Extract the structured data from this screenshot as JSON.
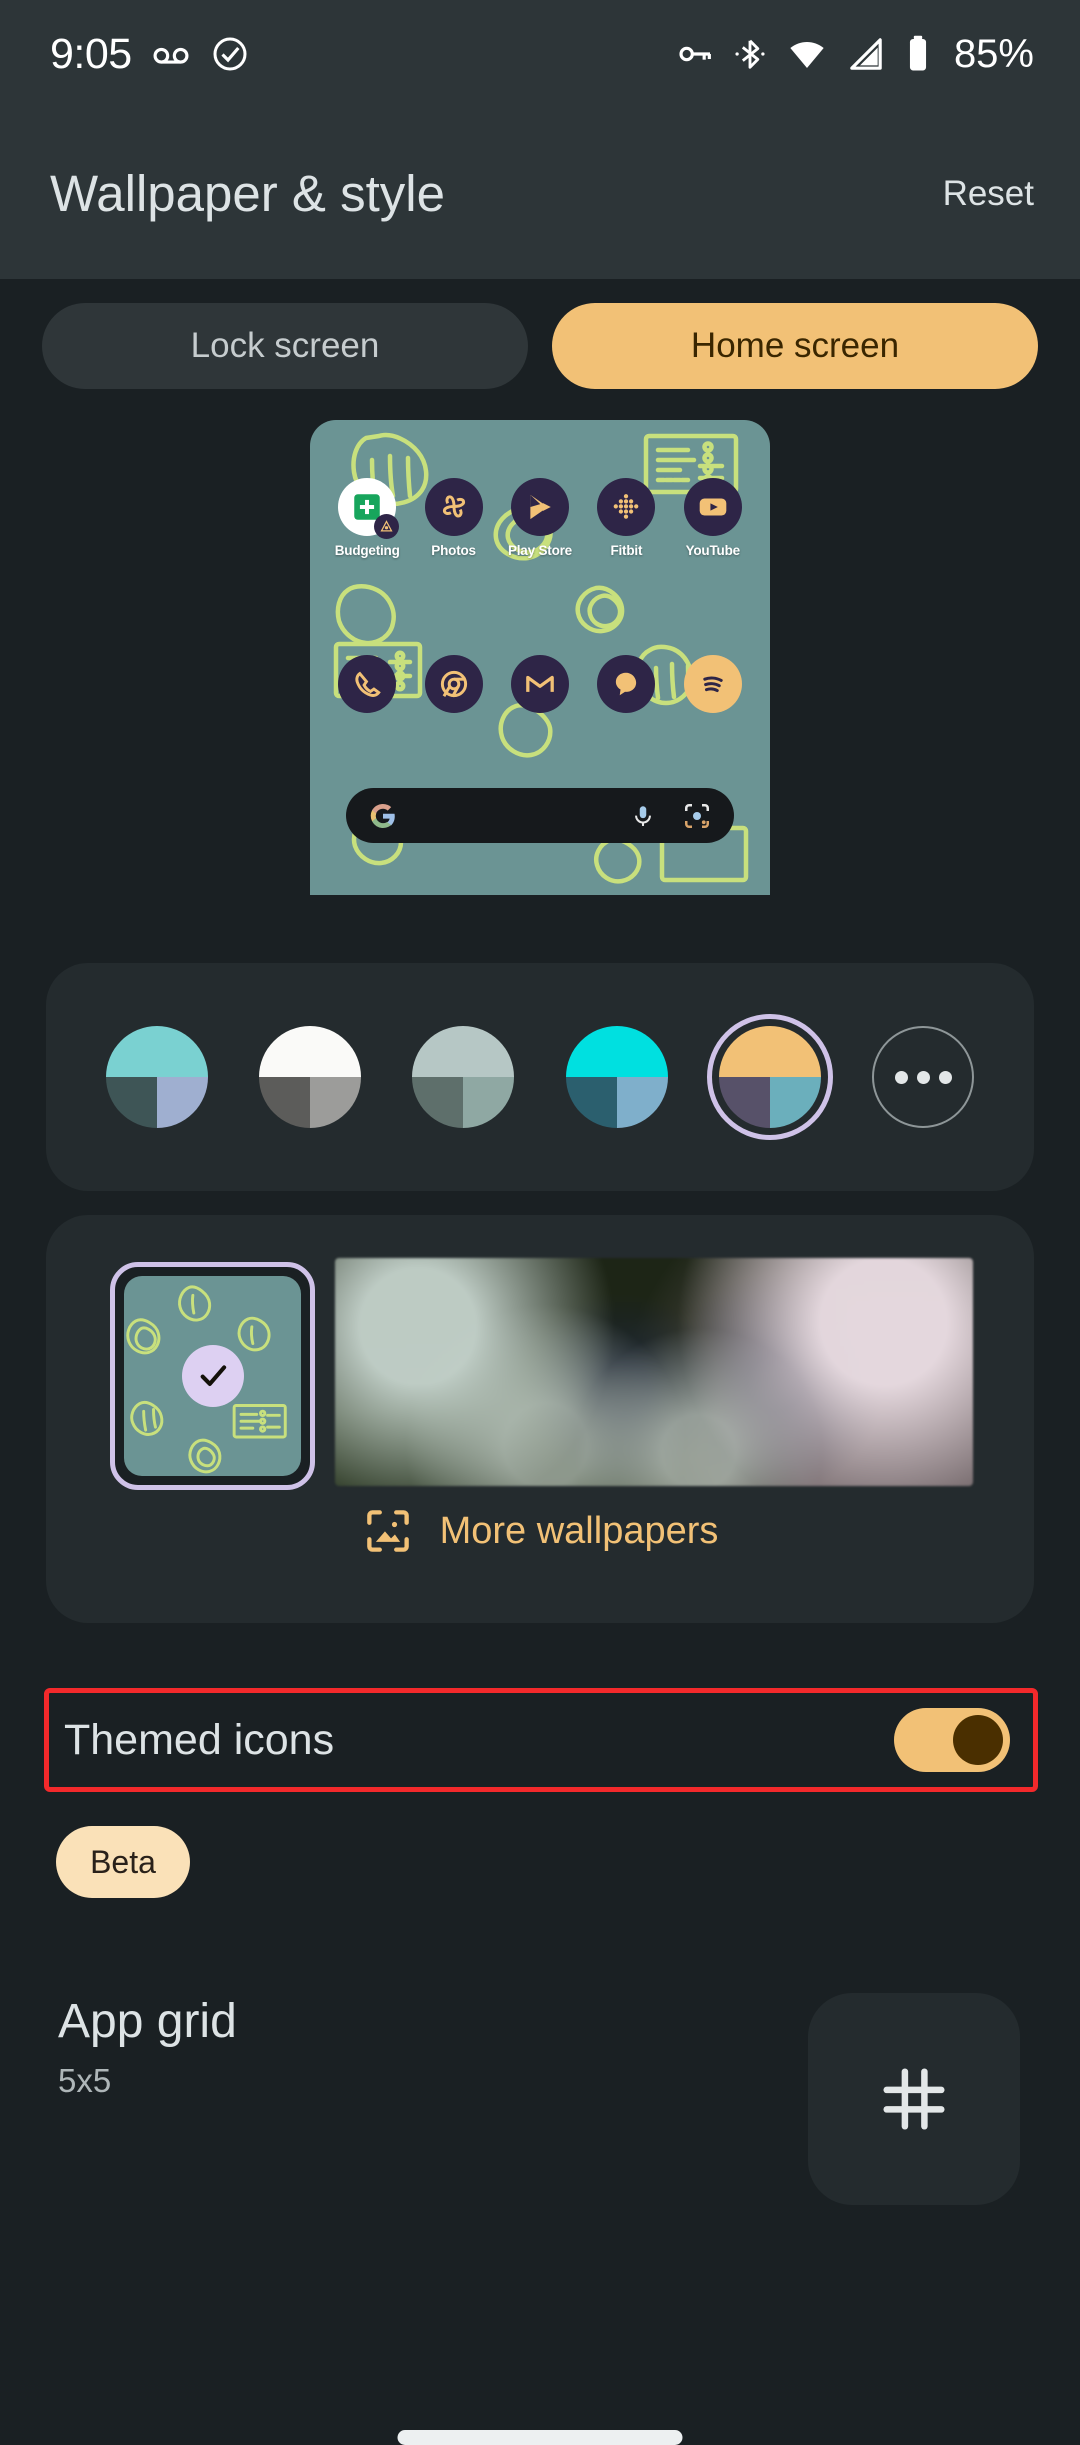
{
  "status_bar": {
    "time": "9:05",
    "battery_percent": "85%",
    "left_icons": [
      "voicemail-icon",
      "check-circle-icon"
    ],
    "right_icons": [
      "vpn-key-icon",
      "bluetooth-icon",
      "wifi-icon",
      "cell-signal-icon",
      "battery-icon"
    ]
  },
  "header": {
    "title": "Wallpaper & style",
    "reset_label": "Reset"
  },
  "tabs": [
    {
      "label": "Lock screen",
      "active": false
    },
    {
      "label": "Home screen",
      "active": true
    }
  ],
  "preview": {
    "wallpaper_bg": "#6B9494",
    "doodle_color": "#C8E07D",
    "row1": [
      {
        "label": "Budgeting",
        "icon": "budgeting-icon"
      },
      {
        "label": "Photos",
        "icon": "google-photos-icon"
      },
      {
        "label": "Play Store",
        "icon": "play-store-icon"
      },
      {
        "label": "Fitbit",
        "icon": "fitbit-icon"
      },
      {
        "label": "YouTube",
        "icon": "youtube-icon"
      }
    ],
    "row2": [
      {
        "label": "",
        "icon": "phone-icon"
      },
      {
        "label": "",
        "icon": "chrome-icon"
      },
      {
        "label": "",
        "icon": "gmail-icon"
      },
      {
        "label": "",
        "icon": "messages-icon"
      },
      {
        "label": "",
        "icon": "spotify-icon"
      }
    ],
    "search": {
      "google_icon": "google-g-icon",
      "mic_icon": "microphone-icon",
      "lens_icon": "google-lens-icon"
    }
  },
  "colors": {
    "swatches": [
      {
        "name": "teal",
        "top": "#7AD1D1",
        "bottom_left": "#3E5556",
        "bottom_right": "#9FAFD0",
        "selected": false
      },
      {
        "name": "white",
        "top": "#FAFAF8",
        "bottom_left": "#5C5C5A",
        "bottom_right": "#9C9C9A",
        "selected": false
      },
      {
        "name": "sage",
        "top": "#B6C7C5",
        "bottom_left": "#5E6F6B",
        "bottom_right": "#8FA8A3",
        "selected": false
      },
      {
        "name": "cyan",
        "top": "#00E0E0",
        "bottom_left": "#2B5F6E",
        "bottom_right": "#7FAFCB",
        "selected": false
      },
      {
        "name": "amber",
        "top": "#F2C176",
        "bottom_left": "#575169",
        "bottom_right": "#6BAFBC",
        "selected": true
      }
    ],
    "more_label": "more-colors-icon",
    "selection_ring": "#CFC2E8"
  },
  "wallpapers": {
    "selected_thumb_checked": true,
    "more_wallpapers_label": "More wallpapers",
    "more_wallpapers_icon": "image-frame-icon",
    "accent": "#F2C176"
  },
  "themed_icons": {
    "label": "Themed icons",
    "enabled": true,
    "beta_label": "Beta",
    "highlight_color": "#F3292B",
    "toggle_color": "#F2C176"
  },
  "app_grid": {
    "title": "App grid",
    "value": "5x5",
    "icon": "grid-hash-icon"
  },
  "nav": {
    "gesture_pill": "home-gesture-pill"
  }
}
